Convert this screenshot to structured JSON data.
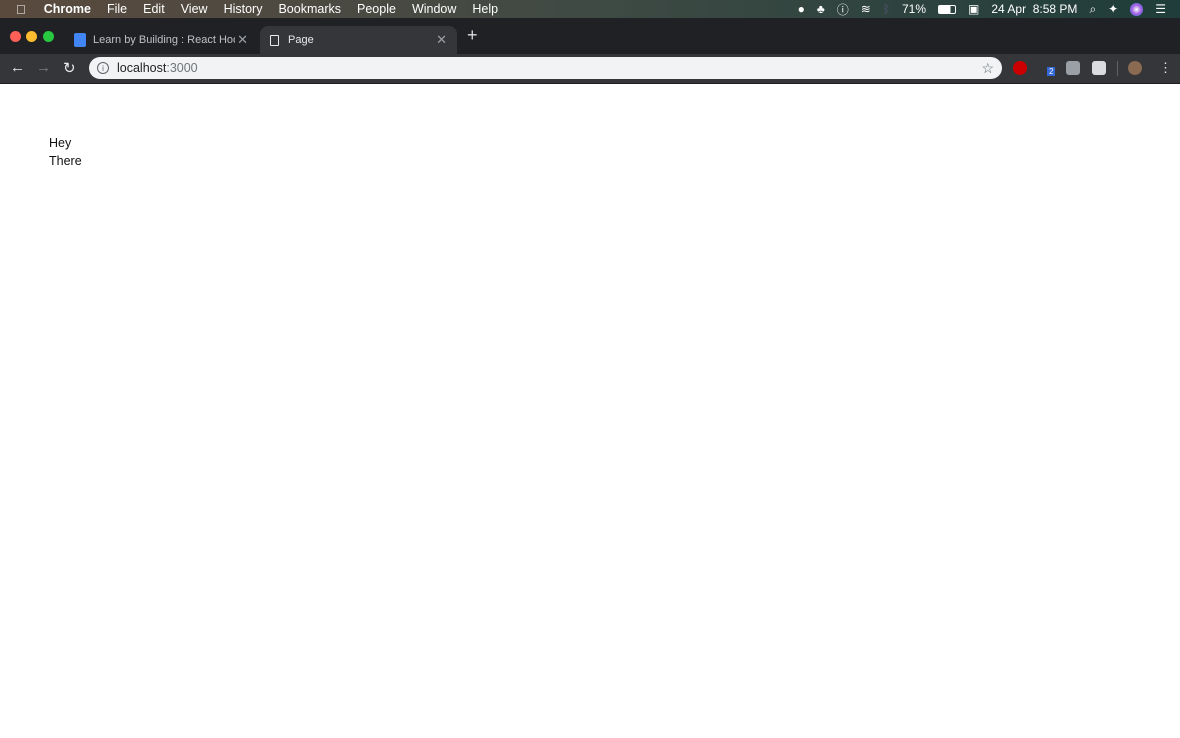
{
  "menubar": {
    "apple_icon": "apple-icon",
    "items": [
      "Chrome",
      "File",
      "Edit",
      "View",
      "History",
      "Bookmarks",
      "People",
      "Window",
      "Help"
    ],
    "battery": "71%",
    "datetime": "24 Apr  8:58 PM"
  },
  "tabs": [
    {
      "title": "Learn by Building : React Hook",
      "icon": "google-docs-icon",
      "active": false
    },
    {
      "title": "Page",
      "icon": "page-icon",
      "active": true
    }
  ],
  "toolbar": {
    "url_host": "localhost",
    "url_port": ":3000",
    "extension_badge": "2"
  },
  "page": {
    "lines": [
      "Hey",
      "There"
    ]
  },
  "colors": {
    "tabstrip": "#202124",
    "toolbar": "#35363a",
    "omnibox": "#f1f3f4"
  }
}
